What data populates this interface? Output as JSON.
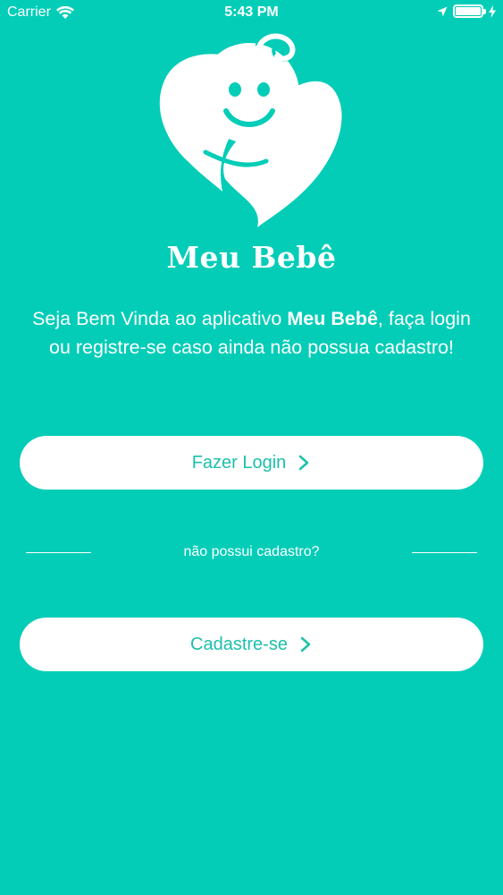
{
  "status_bar": {
    "carrier": "Carrier",
    "time": "5:43 PM",
    "icons": [
      "wifi-icon",
      "location-arrow-icon",
      "battery-icon",
      "charging-bolt-icon"
    ]
  },
  "logo": {
    "icon": "baby-face-heart-logo"
  },
  "app_title": "Meu Bebê",
  "welcome": {
    "prefix": "Seja Bem Vinda ao aplicativo ",
    "app_name": "Meu Bebê",
    "suffix": ", faça login ou registre-se caso ainda não possua cadastro!"
  },
  "buttons": {
    "login_label": "Fazer Login",
    "register_label": "Cadastre-se"
  },
  "divider": {
    "text": "não possui cadastro?"
  },
  "colors": {
    "background": "#03cdb7",
    "button_background": "#ffffff",
    "button_text": "#1dc0ab",
    "text": "#ffffff"
  }
}
